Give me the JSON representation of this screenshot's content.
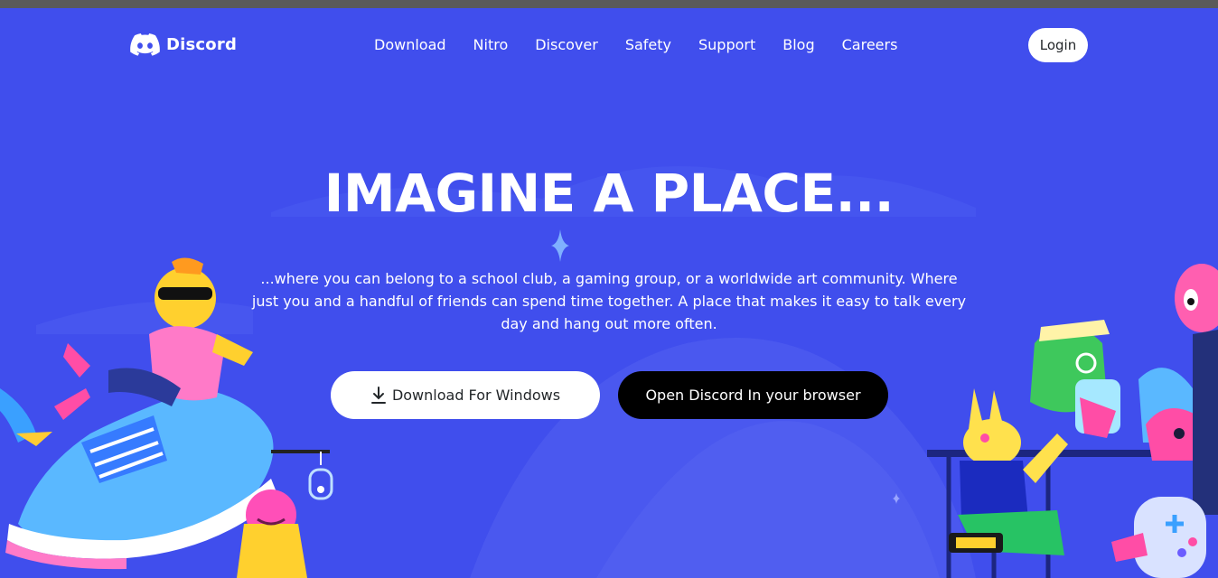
{
  "brand": {
    "name": "Discord",
    "logo_icon": "discord-controller-logo"
  },
  "nav": {
    "links": [
      "Download",
      "Nitro",
      "Discover",
      "Safety",
      "Support",
      "Blog",
      "Careers"
    ],
    "login_label": "Login"
  },
  "hero": {
    "title": "IMAGINE A PLACE...",
    "subtitle": "...where you can belong to a school club, a gaming group, or a worldwide art community. Where just you and a handful of friends can spend time together. A place that makes it easy to talk every day and hang out more often.",
    "download_label": "Download For Windows",
    "download_icon": "download-icon",
    "open_browser_label": "Open Discord In your browser"
  },
  "colors": {
    "background": "#404eed",
    "button_light": "#ffffff",
    "button_dark": "#000000",
    "text": "#ffffff"
  }
}
